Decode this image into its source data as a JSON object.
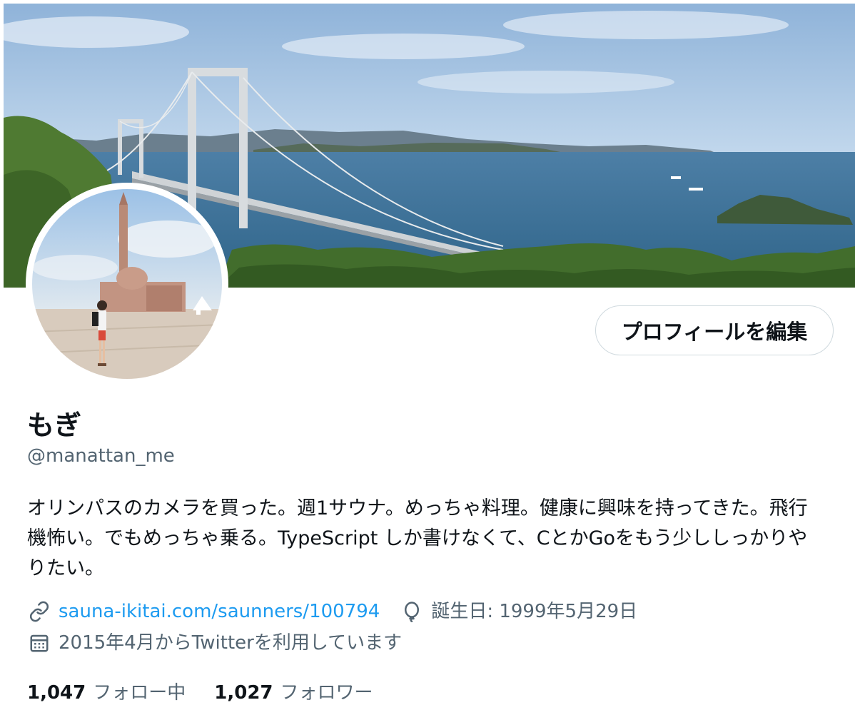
{
  "profile": {
    "display_name": "もぎ",
    "handle": "@manattan_me",
    "edit_button_label": "プロフィールを編集",
    "bio": "オリンパスのカメラを買った。週1サウナ。めっちゃ料理。健康に興味を持ってきた。飛行機怖い。でもめっちゃ乗る。TypeScript しか書けなくて、CとかGoをもう少ししっかりやりたい。"
  },
  "meta": {
    "website": "sauna-ikitai.com/saunners/100794",
    "birthday": "誕生日: 1999年5月29日",
    "joined": "2015年4月からTwitterを利用しています",
    "icons": {
      "website": "link-icon",
      "birthday": "balloon-icon",
      "joined": "calendar-icon"
    }
  },
  "stats": {
    "following_count": "1,047",
    "following_label": "フォロー中",
    "followers_count": "1,027",
    "followers_label": "フォロワー"
  },
  "colors": {
    "link": "#1d9bf0",
    "secondary_text": "#536471",
    "primary_text": "#0f1419",
    "button_border": "#cfd9de"
  }
}
